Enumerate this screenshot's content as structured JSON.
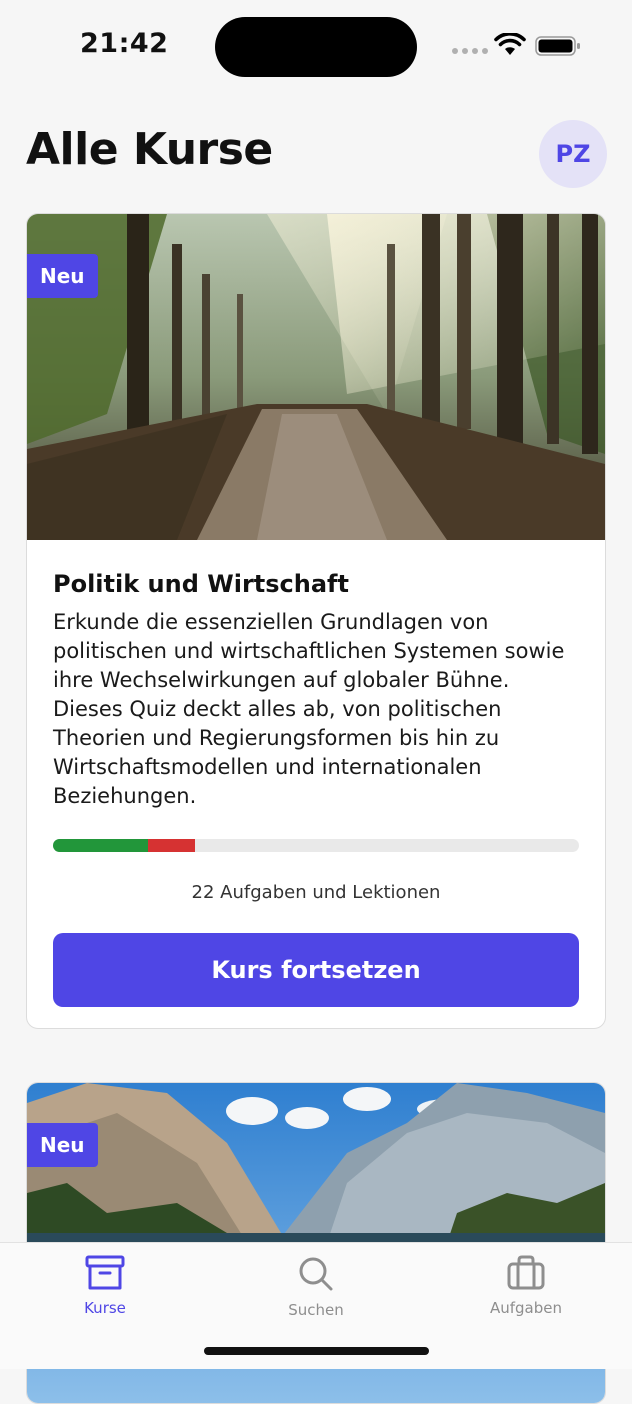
{
  "status_bar": {
    "time": "21:42"
  },
  "header": {
    "title": "Alle Kurse",
    "avatar_initials": "PZ"
  },
  "courses": [
    {
      "badge": "Neu",
      "image": "forest-path-sunbeams",
      "title": "Politik und Wirtschaft",
      "description": "Erkunde die essenziellen Grundlagen von politischen und wirtschaftlichen Systemen sowie ihre Wechselwirkungen auf globaler Bühne. Dieses Quiz deckt alles ab, von politischen Theorien und Regierungsformen bis hin zu Wirtschaftsmodellen und internationalen Beziehungen.",
      "progress": {
        "correct": 0.18,
        "incorrect": 0.09
      },
      "task_count": "22 Aufgaben und Lektionen",
      "cta_label": "Kurs fortsetzen"
    },
    {
      "badge": "Neu",
      "image": "mountain-lake"
    }
  ],
  "tab_bar": {
    "items": [
      {
        "label": "Kurse",
        "icon": "archive-box-icon",
        "active": true
      },
      {
        "label": "Suchen",
        "icon": "search-icon",
        "active": false
      },
      {
        "label": "Aufgaben",
        "icon": "briefcase-icon",
        "active": false
      }
    ]
  },
  "colors": {
    "accent": "#4f46e5",
    "progress_correct": "#22963a",
    "progress_incorrect": "#d63232"
  }
}
